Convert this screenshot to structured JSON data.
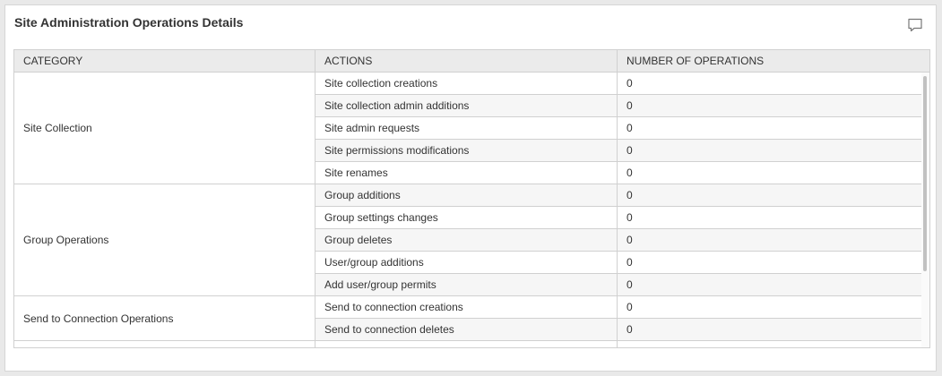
{
  "panel": {
    "title": "Site Administration Operations Details"
  },
  "table": {
    "headers": [
      "CATEGORY",
      "ACTIONS",
      "NUMBER OF OPERATIONS"
    ],
    "groups": [
      {
        "category": "Site Collection",
        "rows": [
          {
            "action": "Site collection creations",
            "count": "0"
          },
          {
            "action": "Site collection admin additions",
            "count": "0"
          },
          {
            "action": "Site admin requests",
            "count": "0"
          },
          {
            "action": "Site permissions modifications",
            "count": "0"
          },
          {
            "action": "Site renames",
            "count": "0"
          }
        ]
      },
      {
        "category": "Group Operations",
        "rows": [
          {
            "action": "Group additions",
            "count": "0"
          },
          {
            "action": "Group settings changes",
            "count": "0"
          },
          {
            "action": "Group deletes",
            "count": "0"
          },
          {
            "action": "User/group additions",
            "count": "0"
          },
          {
            "action": "Add user/group permits",
            "count": "0"
          }
        ]
      },
      {
        "category": "Send to Connection Operations",
        "rows": [
          {
            "action": "Send to connection creations",
            "count": "0"
          },
          {
            "action": "Send to connection deletes",
            "count": "0"
          }
        ]
      }
    ]
  },
  "icons": {
    "comment": "comment-icon"
  }
}
